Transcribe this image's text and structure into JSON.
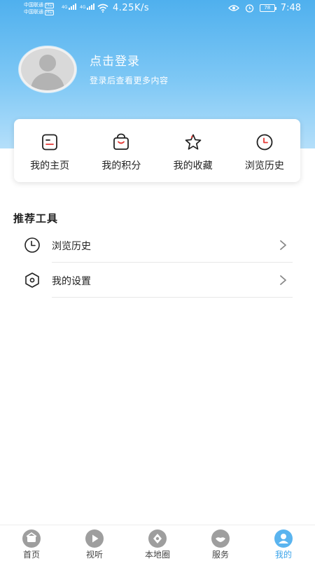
{
  "status_bar": {
    "carrier_1": "中国联通",
    "carrier_2": "中国联通",
    "hd_tag": "HD",
    "network_1": "4G",
    "network_2": "4G",
    "net_speed": "4.25K/s",
    "battery": "78",
    "time": "7:48"
  },
  "profile": {
    "login_title": "点击登录",
    "login_subtitle": "登录后查看更多内容"
  },
  "quick_actions": [
    {
      "label": "我的主页",
      "icon": "profile-card-icon"
    },
    {
      "label": "我的积分",
      "icon": "shopping-bag-icon"
    },
    {
      "label": "我的收藏",
      "icon": "star-icon"
    },
    {
      "label": "浏览历史",
      "icon": "clock-icon"
    }
  ],
  "tools": {
    "title": "推荐工具",
    "items": [
      {
        "label": "浏览历史",
        "icon": "clock-icon"
      },
      {
        "label": "我的设置",
        "icon": "settings-hexagon-icon"
      }
    ]
  },
  "tabbar": {
    "items": [
      {
        "label": "首页",
        "icon": "home-icon"
      },
      {
        "label": "视听",
        "icon": "play-icon"
      },
      {
        "label": "本地圈",
        "icon": "local-circle-icon"
      },
      {
        "label": "服务",
        "icon": "handshake-icon"
      },
      {
        "label": "我的",
        "icon": "user-icon"
      }
    ],
    "active_index": 4
  },
  "colors": {
    "accent": "#3aa3ea",
    "header_top": "#4fb0ee",
    "header_bottom": "#b4dffa",
    "tab_inactive": "#9e9e9e",
    "red_accent": "#e53935"
  }
}
